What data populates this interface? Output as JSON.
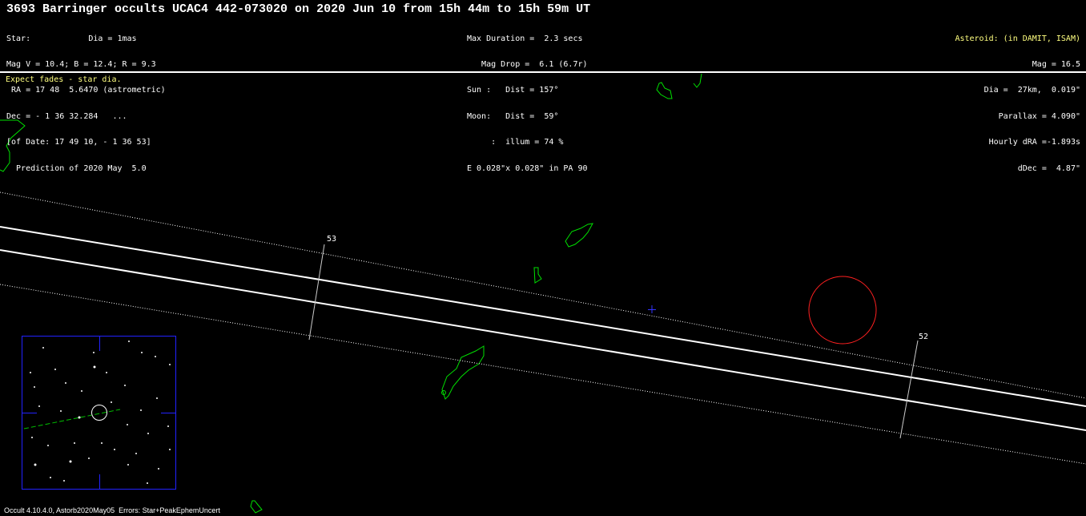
{
  "header": {
    "title": "3693 Barringer occults UCAC4 442-073020 on 2020 Jun 10 from 15h 44m to 15h 59m UT"
  },
  "star_info": [
    "Star:            Dia = 1mas",
    "Mag V = 10.4; B = 12.4; R = 9.3",
    " RA = 17 48  5.6470 (astrometric)",
    "Dec = - 1 36 32.284   ...",
    "[of Date: 17 49 10, - 1 36 53]",
    "  Prediction of 2020 May  5.0"
  ],
  "event_info": [
    "Max Duration =  2.3 secs",
    "   Mag Drop =  6.1 (6.7r)",
    "Sun :   Dist = 157°",
    "Moon:   Dist =  59°",
    "     :  illum = 74 %",
    "E 0.028\"x 0.028\" in PA 90"
  ],
  "asteroid_info": {
    "heading": "Asteroid: (in DAMIT, ISAM)",
    "lines": [
      "Mag = 16.5",
      "Dia =  27km,  0.019\"",
      "Parallax = 4.090\"",
      "Hourly dRA =-1.893s",
      "dDec =  4.87\""
    ]
  },
  "notice": "Expect fades - star dia.",
  "footer": "Occult 4.10.4.0, Astorb2020May05  Errors: Star+PeakEphemUncert",
  "path": {
    "tick_labels": [
      "53",
      "52"
    ]
  },
  "colors": {
    "background": "#000000",
    "text": "#ffffff",
    "highlight": "#ffff80",
    "coastline": "#00e000",
    "path_line": "#ffffff",
    "site_marker": "#ff2020",
    "center_cross": "#3333ff",
    "finder_frame": "#2222ff"
  },
  "finder_chart": {
    "label": "finder-chart"
  }
}
